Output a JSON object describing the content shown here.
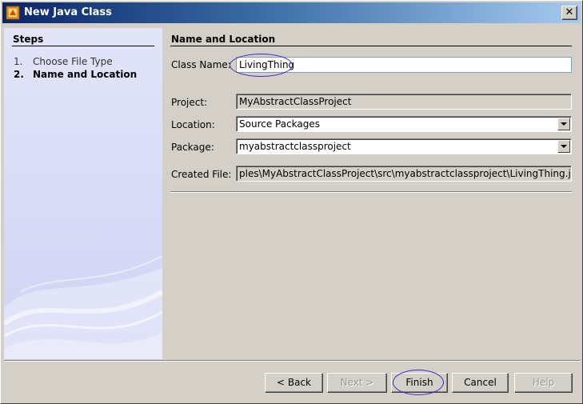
{
  "window": {
    "title": "New Java Class"
  },
  "steps": {
    "title": "Steps",
    "items": [
      {
        "number": "1.",
        "label": "Choose File Type"
      },
      {
        "number": "2.",
        "label": "Name and Location"
      }
    ]
  },
  "form": {
    "section_title": "Name and Location",
    "class_name_label": "Class Name:",
    "class_name_value": "LivingThing",
    "project_label": "Project:",
    "project_value": "MyAbstractClassProject",
    "location_label": "Location:",
    "location_value": "Source Packages",
    "package_label": "Package:",
    "package_value": "myabstractclassproject",
    "created_file_label": "Created File:",
    "created_file_value": "ples\\MyAbstractClassProject\\src\\myabstractclassproject\\LivingThing.java"
  },
  "buttons": {
    "back": "< Back",
    "next": "Next >",
    "finish": "Finish",
    "cancel": "Cancel",
    "help": "Help"
  },
  "colors": {
    "titlebar_start": "#0a246a",
    "titlebar_end": "#a6caf0",
    "highlight_ellipse": "#3a2acc",
    "steps_panel": "#d8dbf6"
  }
}
